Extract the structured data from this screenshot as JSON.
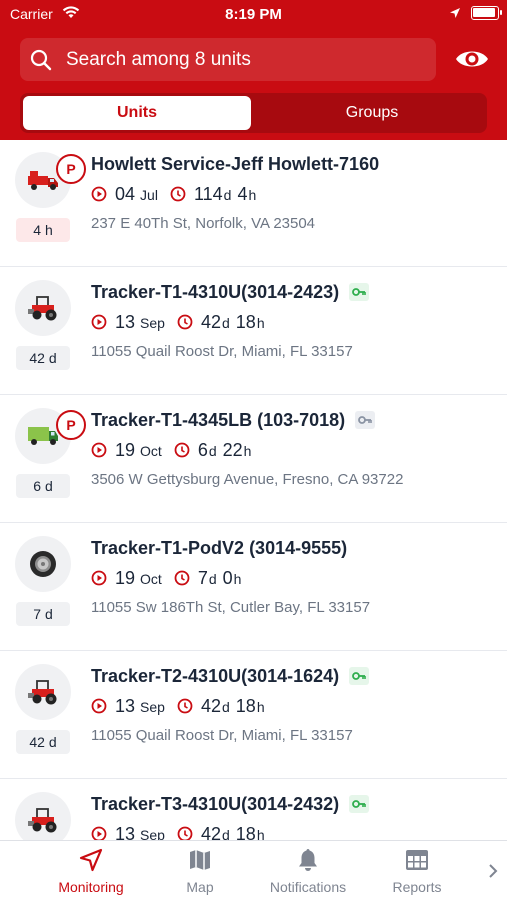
{
  "status_bar": {
    "carrier": "Carrier",
    "time": "8:19 PM"
  },
  "search": {
    "placeholder": "Search among 8 units"
  },
  "segments": {
    "units": "Units",
    "groups": "Groups",
    "selected": "Units"
  },
  "colors": {
    "brand": "#c90c12",
    "brand_dark": "#a70a0f",
    "key_green": "#2fae4e",
    "key_gray": "#8a93a3"
  },
  "units": [
    {
      "name": "Howlett Service-Jeff Howlett-7160",
      "icon": "red-truck-icon",
      "parked": true,
      "parked_label": "P",
      "age": "4 h",
      "age_highlight": true,
      "key": null,
      "date_day": "04",
      "date_month": "Jul",
      "dur_a": "114",
      "dur_a_unit": "d",
      "dur_b": "4",
      "dur_b_unit": "h",
      "address": "237 E 40Th St, Norfolk, VA 23504"
    },
    {
      "name": "Tracker-T1-4310U(3014-2423)",
      "icon": "red-tractor-icon",
      "parked": false,
      "age": "42 d",
      "age_highlight": false,
      "key": "green",
      "date_day": "13",
      "date_month": "Sep",
      "dur_a": "42",
      "dur_a_unit": "d",
      "dur_b": "18",
      "dur_b_unit": "h",
      "address": "11055 Quail Roost Dr, Miami, FL 33157"
    },
    {
      "name": "Tracker-T1-4345LB (103-7018)",
      "icon": "green-truck-icon",
      "parked": true,
      "parked_label": "P",
      "age": "6 d",
      "age_highlight": false,
      "key": "gray",
      "date_day": "19",
      "date_month": "Oct",
      "dur_a": "6",
      "dur_a_unit": "d",
      "dur_b": "22",
      "dur_b_unit": "h",
      "address": "3506 W Gettysburg Avenue, Fresno, CA 93722"
    },
    {
      "name": "Tracker-T1-PodV2 (3014-9555)",
      "icon": "tire-icon",
      "parked": false,
      "age": "7 d",
      "age_highlight": false,
      "key": null,
      "date_day": "19",
      "date_month": "Oct",
      "dur_a": "7",
      "dur_a_unit": "d",
      "dur_b": "0",
      "dur_b_unit": "h",
      "address": "11055 Sw 186Th St, Cutler Bay, FL 33157"
    },
    {
      "name": "Tracker-T2-4310U(3014-1624)",
      "icon": "red-tractor-icon",
      "parked": false,
      "age": "42 d",
      "age_highlight": false,
      "key": "green",
      "date_day": "13",
      "date_month": "Sep",
      "dur_a": "42",
      "dur_a_unit": "d",
      "dur_b": "18",
      "dur_b_unit": "h",
      "address": "11055 Quail Roost Dr, Miami, FL 33157"
    },
    {
      "name": "Tracker-T3-4310U(3014-2432)",
      "icon": "red-tractor-icon",
      "parked": false,
      "age": "",
      "age_highlight": false,
      "key": "green",
      "date_day": "13",
      "date_month": "Sep",
      "dur_a": "42",
      "dur_a_unit": "d",
      "dur_b": "18",
      "dur_b_unit": "h",
      "address": ""
    }
  ],
  "tabs": [
    {
      "label": "Monitoring",
      "icon": "navigation-arrow-icon",
      "active": true
    },
    {
      "label": "Map",
      "icon": "map-icon",
      "active": false
    },
    {
      "label": "Notifications",
      "icon": "bell-icon",
      "active": false
    },
    {
      "label": "Reports",
      "icon": "reports-table-icon",
      "active": false
    }
  ]
}
